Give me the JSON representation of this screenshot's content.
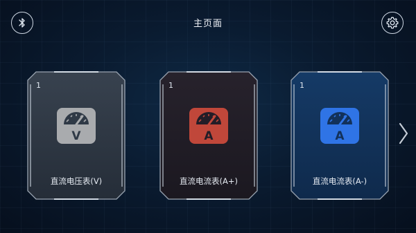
{
  "header": {
    "title": "主页面",
    "bluetooth_icon": "bluetooth-icon",
    "settings_icon": "gear-icon"
  },
  "cards": [
    {
      "index": "1",
      "label": "直流电压表(V)",
      "meter_letter": "V",
      "icon": "voltmeter-icon",
      "accent_color": "#a9abae",
      "panel_color": "#2f3946"
    },
    {
      "index": "1",
      "label": "直流电流表(A+)",
      "meter_letter": "A",
      "icon": "ammeter-icon",
      "accent_color": "#c0473a",
      "panel_color": "#221d27"
    },
    {
      "index": "1",
      "label": "直流电流表(A-)",
      "meter_letter": "A",
      "icon": "ammeter-icon",
      "accent_color": "#2f74e6",
      "panel_color": "#12315a"
    }
  ],
  "navigation": {
    "next_icon": "chevron-right-icon"
  }
}
